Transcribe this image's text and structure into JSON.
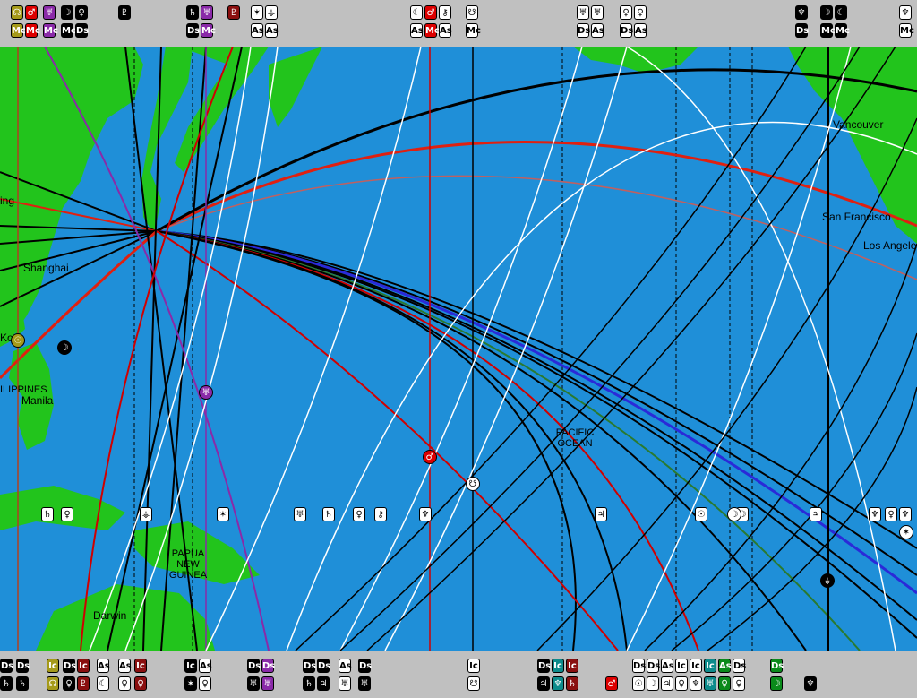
{
  "cities": [
    {
      "name": "Vancouver",
      "key": "vancouver"
    },
    {
      "name": "San Francisco",
      "key": "san-francisco"
    },
    {
      "name": "Los Angeles",
      "key": "los-angeles"
    },
    {
      "name": "Shanghai",
      "key": "shanghai"
    },
    {
      "name": "Manila",
      "key": "manila"
    },
    {
      "name": "Darwin",
      "key": "darwin"
    }
  ],
  "regions": {
    "ocean_line1": "PACIFIC",
    "ocean_line2": "OCEAN",
    "png_line1": "PAPUA",
    "png_line2": "NEW",
    "png_line3": "GUINEA",
    "philippines": "ILIPPINES",
    "beijing": "ing",
    "korea": "Ko"
  },
  "colors": {
    "ocean": "#1f8fd8",
    "land": "#22c41c",
    "toolbar": "#c0c0c0",
    "sun_line": "#e02010",
    "mars_line": "#d00000",
    "venus_line": "#2a2ad8",
    "pluto_line": "#8a2aa8"
  },
  "top_labels": [
    {
      "g": "☊",
      "a": "Mc",
      "c": "olive"
    },
    {
      "g": "♂",
      "a": "Mc",
      "c": "red"
    },
    {
      "g": "♅",
      "a": "Mc",
      "c": "purple"
    },
    {
      "g": "☽",
      "a": "Mc",
      "c": "black"
    },
    {
      "g": "♀",
      "a": "Ds",
      "c": "black"
    },
    {
      "g": "♇",
      "a": "",
      "c": "black"
    },
    {
      "g": "♄",
      "a": "Ds",
      "c": "black"
    },
    {
      "g": "♅",
      "a": "Mc",
      "c": "purple"
    },
    {
      "g": "♇",
      "a": "",
      "c": "maroon"
    },
    {
      "g": "✶",
      "a": "As",
      "c": "white"
    },
    {
      "g": "⚶",
      "a": "As",
      "c": "white"
    },
    {
      "g": "☾",
      "a": "As",
      "c": "white"
    },
    {
      "g": "♂",
      "a": "Mc",
      "c": "red"
    },
    {
      "g": "⚷",
      "a": "As",
      "c": "white"
    },
    {
      "g": "☋",
      "a": "Mc",
      "c": "white"
    },
    {
      "g": "♅",
      "a": "Ds",
      "c": "white"
    },
    {
      "g": "♅",
      "a": "As",
      "c": "white"
    },
    {
      "g": "♀",
      "a": "Ds",
      "c": "white"
    },
    {
      "g": "♀",
      "a": "As",
      "c": "white"
    },
    {
      "g": "♆",
      "a": "Ds",
      "c": "black"
    },
    {
      "g": "☽",
      "a": "Mc",
      "c": "black"
    },
    {
      "g": "☾",
      "a": "Mc",
      "c": "black"
    },
    {
      "g": "♆",
      "a": "Mc",
      "c": "white"
    }
  ],
  "bottom_labels": [
    {
      "a": "Ds",
      "g": "♄"
    },
    {
      "a": "Ds",
      "g": "♄"
    },
    {
      "a": "Ic",
      "g": "☊"
    },
    {
      "a": "Ds",
      "g": "♀"
    },
    {
      "a": "Ic",
      "g": "♇"
    },
    {
      "a": "As",
      "g": "☾"
    },
    {
      "a": "As",
      "g": "♀"
    },
    {
      "a": "Ic",
      "g": "♀"
    },
    {
      "a": "Ic",
      "g": "✶"
    },
    {
      "a": "As",
      "g": "♀"
    },
    {
      "a": "Ds",
      "g": "♅"
    },
    {
      "a": "Ds",
      "g": "♅"
    },
    {
      "a": "Ds",
      "g": "♄"
    },
    {
      "a": "Ds",
      "g": "♃"
    },
    {
      "a": "As",
      "g": "♅"
    },
    {
      "a": "Ds",
      "g": "♅"
    },
    {
      "a": "Ic",
      "g": "☋"
    },
    {
      "a": "Ds",
      "g": "♃"
    },
    {
      "a": "Ic",
      "g": "♆"
    },
    {
      "a": "Ic",
      "g": "♄"
    },
    {
      "a": "",
      "g": "♂"
    },
    {
      "a": "Ds",
      "g": "☉"
    },
    {
      "a": "Ds",
      "g": "☽"
    },
    {
      "a": "As",
      "g": "♃"
    },
    {
      "a": "Ic",
      "g": "♀"
    },
    {
      "a": "Ic",
      "g": "♆"
    },
    {
      "a": "Ic",
      "g": "♅"
    },
    {
      "a": "As",
      "g": "♀"
    },
    {
      "a": "Ds",
      "g": "♀"
    },
    {
      "a": "Ds",
      "g": "☽"
    },
    {
      "a": "",
      "g": "♆"
    }
  ],
  "map_markers": [
    {
      "g": "☉",
      "c": "olive"
    },
    {
      "g": "☽",
      "c": "black"
    },
    {
      "g": "♅",
      "c": "purple"
    },
    {
      "g": "♂",
      "c": "red"
    },
    {
      "g": "☋",
      "c": "white"
    },
    {
      "g": "☽",
      "c": "white"
    },
    {
      "g": "⚶",
      "c": "black"
    },
    {
      "g": "✶",
      "c": "white"
    }
  ],
  "mid_labels": [
    {
      "g": "♄",
      "c": "white"
    },
    {
      "g": "♀",
      "c": "white"
    },
    {
      "g": "⚶",
      "c": "white"
    },
    {
      "g": "✶",
      "c": "white"
    },
    {
      "g": "♅",
      "c": "white"
    },
    {
      "g": "♄",
      "c": "white"
    },
    {
      "g": "♀",
      "c": "white"
    },
    {
      "g": "⚷",
      "c": "white"
    },
    {
      "g": "♆",
      "c": "white"
    },
    {
      "g": "♃",
      "c": "white"
    },
    {
      "g": "☉",
      "c": "white"
    },
    {
      "g": "☽",
      "c": "white"
    },
    {
      "g": "♃",
      "c": "white"
    },
    {
      "g": "♆",
      "c": "white"
    },
    {
      "g": "♀",
      "c": "white"
    },
    {
      "g": "♆",
      "c": "white"
    }
  ]
}
